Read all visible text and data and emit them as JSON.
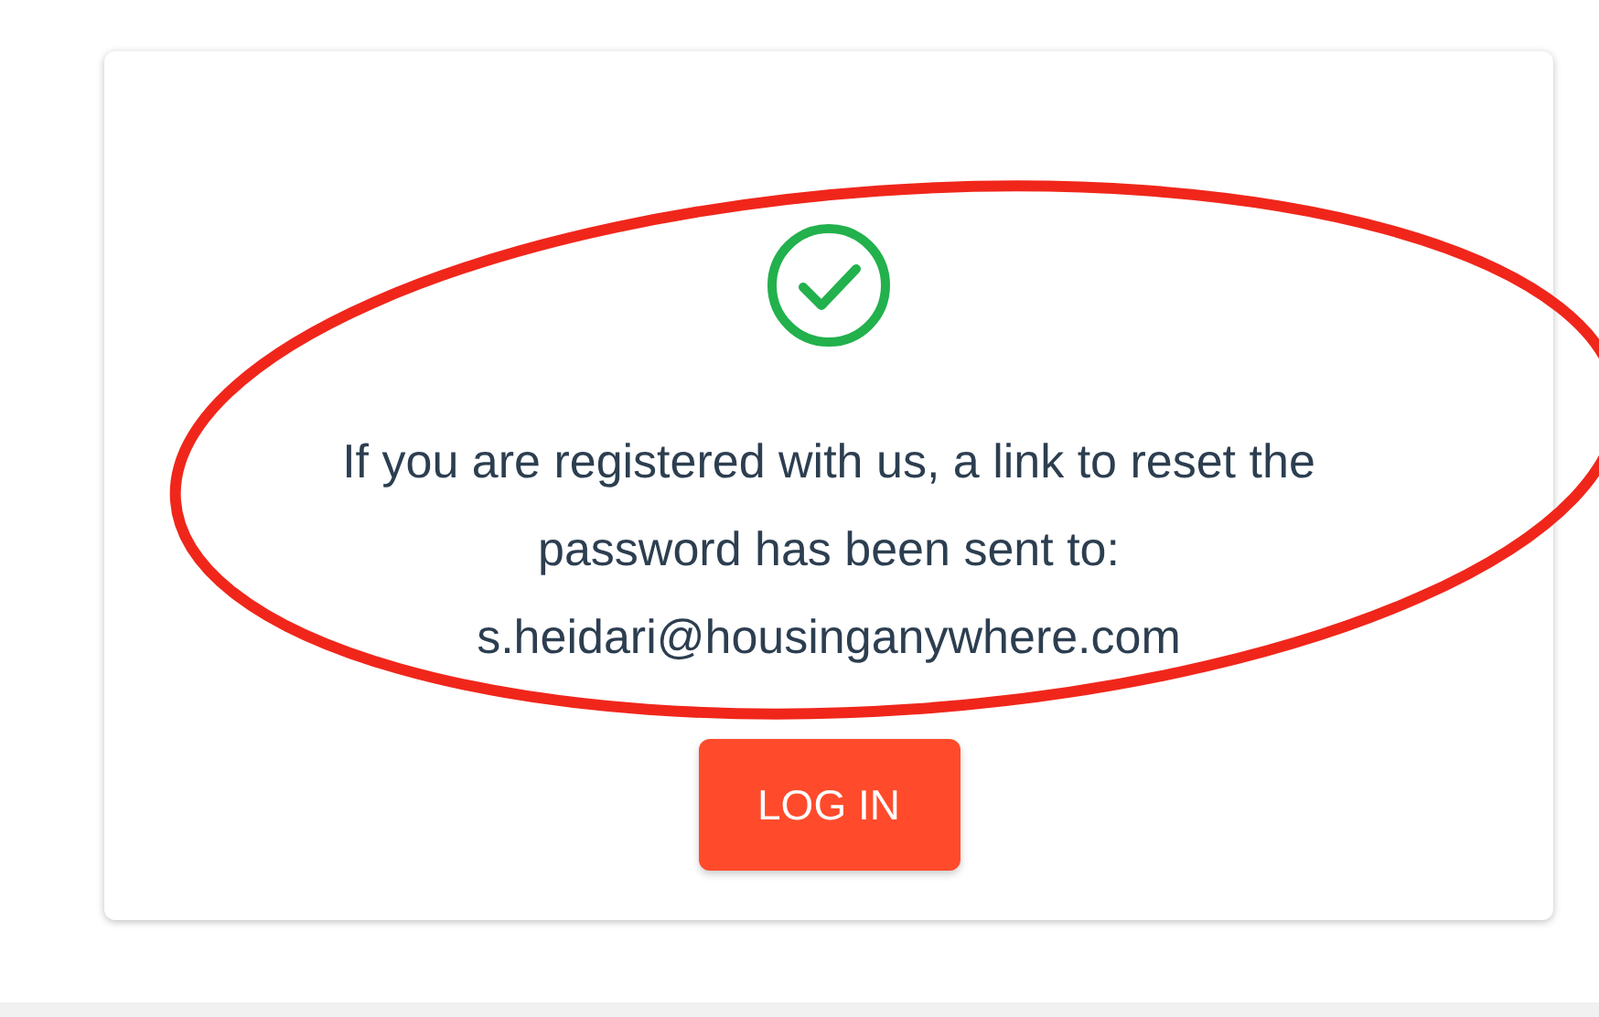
{
  "message": {
    "lines": [
      "If you are registered with us, a link to reset the",
      "password has been sent to:",
      "s.heidari@housinganywhere.com"
    ]
  },
  "button": {
    "label": "LOG IN"
  }
}
